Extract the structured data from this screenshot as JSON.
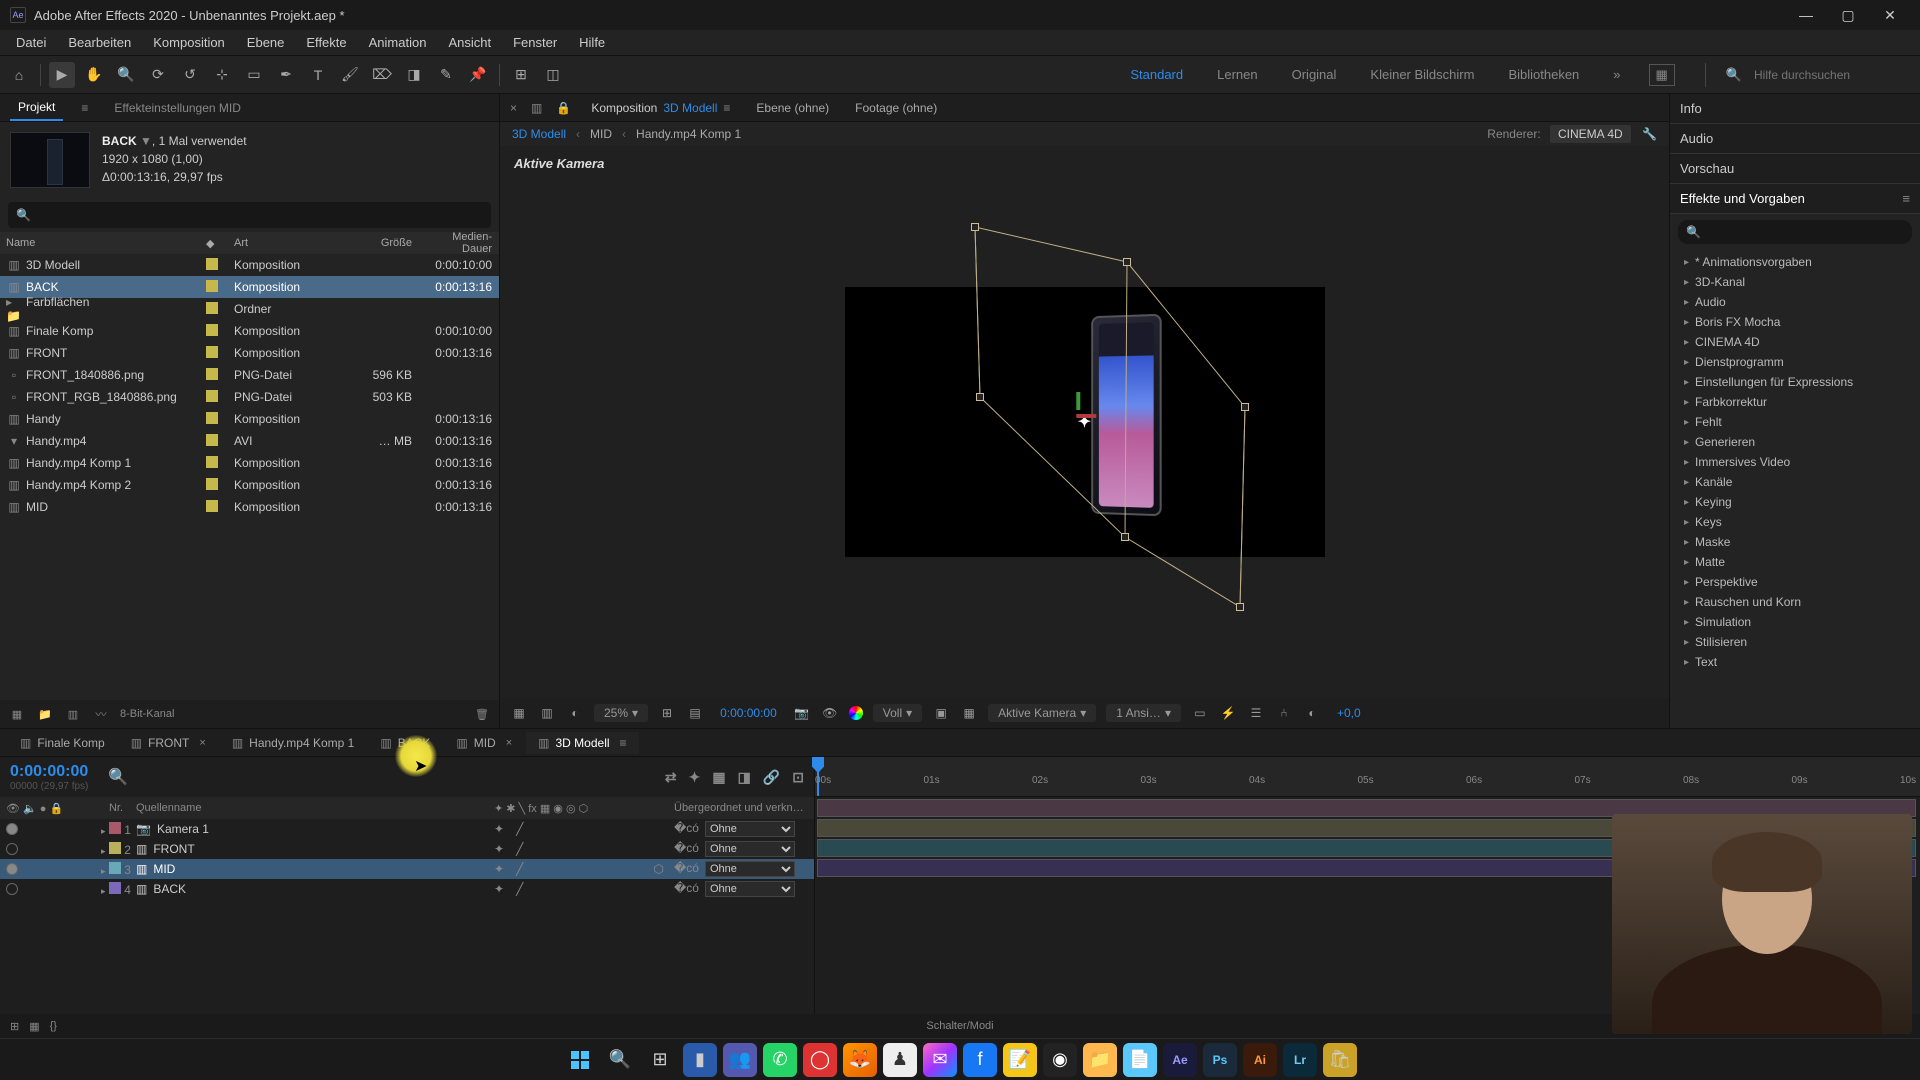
{
  "titlebar": {
    "app": "Ae",
    "title": "Adobe After Effects 2020 - Unbenanntes Projekt.aep *"
  },
  "menu": [
    "Datei",
    "Bearbeiten",
    "Komposition",
    "Ebene",
    "Effekte",
    "Animation",
    "Ansicht",
    "Fenster",
    "Hilfe"
  ],
  "workspaces": {
    "items": [
      "Standard",
      "Lernen",
      "Original",
      "Kleiner Bildschirm",
      "Bibliotheken"
    ],
    "active": "Standard",
    "search_placeholder": "Hilfe durchsuchen"
  },
  "project_panel": {
    "tabs": [
      "Projekt",
      "Effekteinstellungen MID"
    ],
    "active_tab": "Projekt",
    "info": {
      "name": "BACK",
      "usage": ", 1 Mal verwendet",
      "dims": "1920 x 1080 (1,00)",
      "dur": "Δ0:00:13:16, 29,97 fps"
    },
    "columns": {
      "name": "Name",
      "type": "Art",
      "size": "Größe",
      "dur": "Medien-Dauer"
    },
    "rows": [
      {
        "icon": "comp",
        "name": "3D Modell",
        "type": "Komposition",
        "size": "",
        "dur": "0:00:10:00"
      },
      {
        "icon": "comp",
        "name": "BACK",
        "type": "Komposition",
        "size": "",
        "dur": "0:00:13:16",
        "selected": true
      },
      {
        "icon": "folder",
        "name": "Farbflächen",
        "type": "Ordner",
        "size": "",
        "dur": ""
      },
      {
        "icon": "comp",
        "name": "Finale Komp",
        "type": "Komposition",
        "size": "",
        "dur": "0:00:10:00"
      },
      {
        "icon": "comp",
        "name": "FRONT",
        "type": "Komposition",
        "size": "",
        "dur": "0:00:13:16"
      },
      {
        "icon": "img",
        "name": "FRONT_1840886.png",
        "type": "PNG-Datei",
        "size": "596 KB",
        "dur": ""
      },
      {
        "icon": "img",
        "name": "FRONT_RGB_1840886.png",
        "type": "PNG-Datei",
        "size": "503 KB",
        "dur": ""
      },
      {
        "icon": "comp",
        "name": "Handy",
        "type": "Komposition",
        "size": "",
        "dur": "0:00:13:16"
      },
      {
        "icon": "vid",
        "name": "Handy.mp4",
        "type": "AVI",
        "size": "… MB",
        "dur": "0:00:13:16"
      },
      {
        "icon": "comp",
        "name": "Handy.mp4 Komp 1",
        "type": "Komposition",
        "size": "",
        "dur": "0:00:13:16"
      },
      {
        "icon": "comp",
        "name": "Handy.mp4 Komp 2",
        "type": "Komposition",
        "size": "",
        "dur": "0:00:13:16"
      },
      {
        "icon": "comp",
        "name": "MID",
        "type": "Komposition",
        "size": "",
        "dur": "0:00:13:16"
      }
    ],
    "footer_depth": "8-Bit-Kanal"
  },
  "viewer": {
    "tabs": [
      "Komposition 3D Modell",
      "Ebene (ohne)",
      "Footage (ohne)"
    ],
    "breadcrumb": [
      "3D Modell",
      "MID",
      "Handy.mp4 Komp 1"
    ],
    "renderer_label": "Renderer:",
    "renderer_value": "CINEMA 4D",
    "stage_label": "Aktive Kamera",
    "footer": {
      "zoom": "25%",
      "timecode": "0:00:00:00",
      "resolution_label": "Voll",
      "camera": "Aktive Kamera",
      "views": "1 Ansi…",
      "exposure": "+0,0"
    }
  },
  "right": {
    "panels": [
      "Info",
      "Audio",
      "Vorschau",
      "Effekte und Vorgaben"
    ],
    "effects_items": [
      "* Animationsvorgaben",
      "3D-Kanal",
      "Audio",
      "Boris FX Mocha",
      "CINEMA 4D",
      "Dienstprogramm",
      "Einstellungen für Expressions",
      "Farbkorrektur",
      "Fehlt",
      "Generieren",
      "Immersives Video",
      "Kanäle",
      "Keying",
      "Keys",
      "Maske",
      "Matte",
      "Perspektive",
      "Rauschen und Korn",
      "Simulation",
      "Stilisieren",
      "Text"
    ]
  },
  "timeline": {
    "tabs": [
      {
        "label": "Finale Komp"
      },
      {
        "label": "FRONT",
        "closable": true
      },
      {
        "label": "Handy.mp4 Komp 1"
      },
      {
        "label": "BACK"
      },
      {
        "label": "MID",
        "closable": true
      },
      {
        "label": "3D Modell",
        "active": true
      }
    ],
    "timecode": "0:00:00:00",
    "fps_note": "00000 (29,97 fps)",
    "cols": {
      "nr": "Nr.",
      "name": "Quellenname",
      "parent": "Übergeordnet und verkn…"
    },
    "parent_none": "Ohne",
    "layers": [
      {
        "nr": 1,
        "name": "Kamera 1",
        "icon": "camera",
        "color": "c1",
        "eye": true
      },
      {
        "nr": 2,
        "name": "FRONT",
        "icon": "comp",
        "color": "c2"
      },
      {
        "nr": 3,
        "name": "MID",
        "icon": "comp",
        "color": "c3",
        "selected": true,
        "eye": true,
        "cube": true
      },
      {
        "nr": 4,
        "name": "BACK",
        "icon": "comp",
        "color": "c4"
      }
    ],
    "ruler": [
      "00s",
      "01s",
      "02s",
      "03s",
      "04s",
      "05s",
      "06s",
      "07s",
      "08s",
      "09s",
      "10s"
    ],
    "footer_center": "Schalter/Modi"
  }
}
